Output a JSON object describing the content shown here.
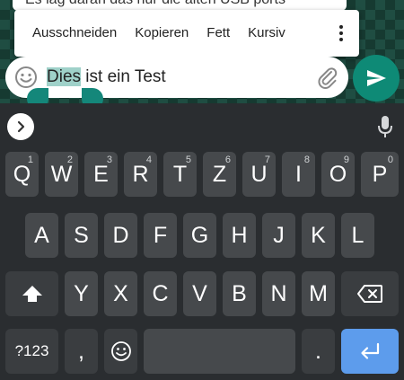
{
  "chat": {
    "peek_text": "Es lag daran das nur die alten USB ports"
  },
  "selection_toolbar": {
    "items": [
      {
        "label": "Ausschneiden"
      },
      {
        "label": "Kopieren"
      },
      {
        "label": "Fett"
      },
      {
        "label": "Kursiv"
      }
    ],
    "more_icon": "overflow-menu-icon"
  },
  "input": {
    "selected_text": "Dies",
    "rest_text": " ist ein Test",
    "emoji_icon": "emoji-icon",
    "attach_icon": "paperclip-icon",
    "selection_color": "#9fd1c9",
    "handle_color": "#14877a"
  },
  "send": {
    "icon": "send-icon",
    "color": "#0e8a76"
  },
  "keyboard": {
    "expand_icon": "chevron-right-icon",
    "mic_icon": "microphone-icon",
    "row1": [
      {
        "label": "Q",
        "hint": "1"
      },
      {
        "label": "W",
        "hint": "2"
      },
      {
        "label": "E",
        "hint": "3"
      },
      {
        "label": "R",
        "hint": "4"
      },
      {
        "label": "T",
        "hint": "5"
      },
      {
        "label": "Z",
        "hint": "6"
      },
      {
        "label": "U",
        "hint": "7"
      },
      {
        "label": "I",
        "hint": "8"
      },
      {
        "label": "O",
        "hint": "9"
      },
      {
        "label": "P",
        "hint": "0"
      }
    ],
    "row2": [
      "A",
      "S",
      "D",
      "F",
      "G",
      "H",
      "J",
      "K",
      "L"
    ],
    "row3": [
      "Y",
      "X",
      "C",
      "V",
      "B",
      "N",
      "M"
    ],
    "shift_icon": "shift-icon",
    "backspace_icon": "backspace-icon",
    "symbols_label": "?123",
    "comma_label": ",",
    "emoji_icon": "emoji-icon",
    "period_label": ".",
    "enter_icon": "enter-icon",
    "enter_color": "#5d9cec"
  }
}
